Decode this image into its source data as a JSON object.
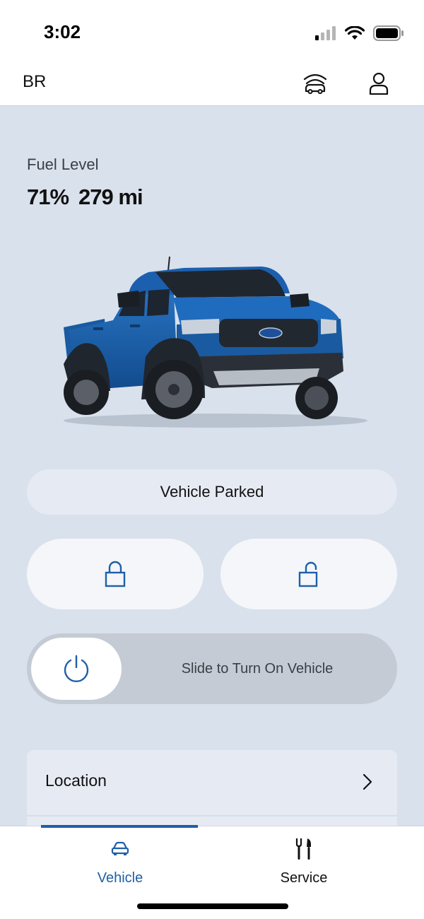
{
  "status_bar": {
    "time": "3:02",
    "icons": [
      "cellular-signal-icon",
      "wifi-icon",
      "battery-icon"
    ]
  },
  "header": {
    "title": "BR",
    "icons": [
      "garage-icon",
      "account-icon"
    ]
  },
  "fuel": {
    "label": "Fuel Level",
    "percent": "71%",
    "range": "279 mi"
  },
  "vehicle": {
    "image_icon": "pickup-truck-image",
    "body_color": "#1b5fae"
  },
  "status": {
    "text": "Vehicle Parked"
  },
  "controls": {
    "lock_icon": "lock-icon",
    "unlock_icon": "unlock-icon",
    "remote_start_label": "Slide to Turn On Vehicle",
    "remote_start_icon": "power-icon"
  },
  "location": {
    "label": "Location",
    "icon": "chevron-right-icon"
  },
  "bottom_nav": {
    "items": [
      {
        "label": "Vehicle",
        "icon": "car-icon",
        "active": true
      },
      {
        "label": "Service",
        "icon": "tools-icon",
        "active": false
      }
    ]
  },
  "colors": {
    "accent": "#1f5fa8",
    "background": "#d9e1ec"
  }
}
